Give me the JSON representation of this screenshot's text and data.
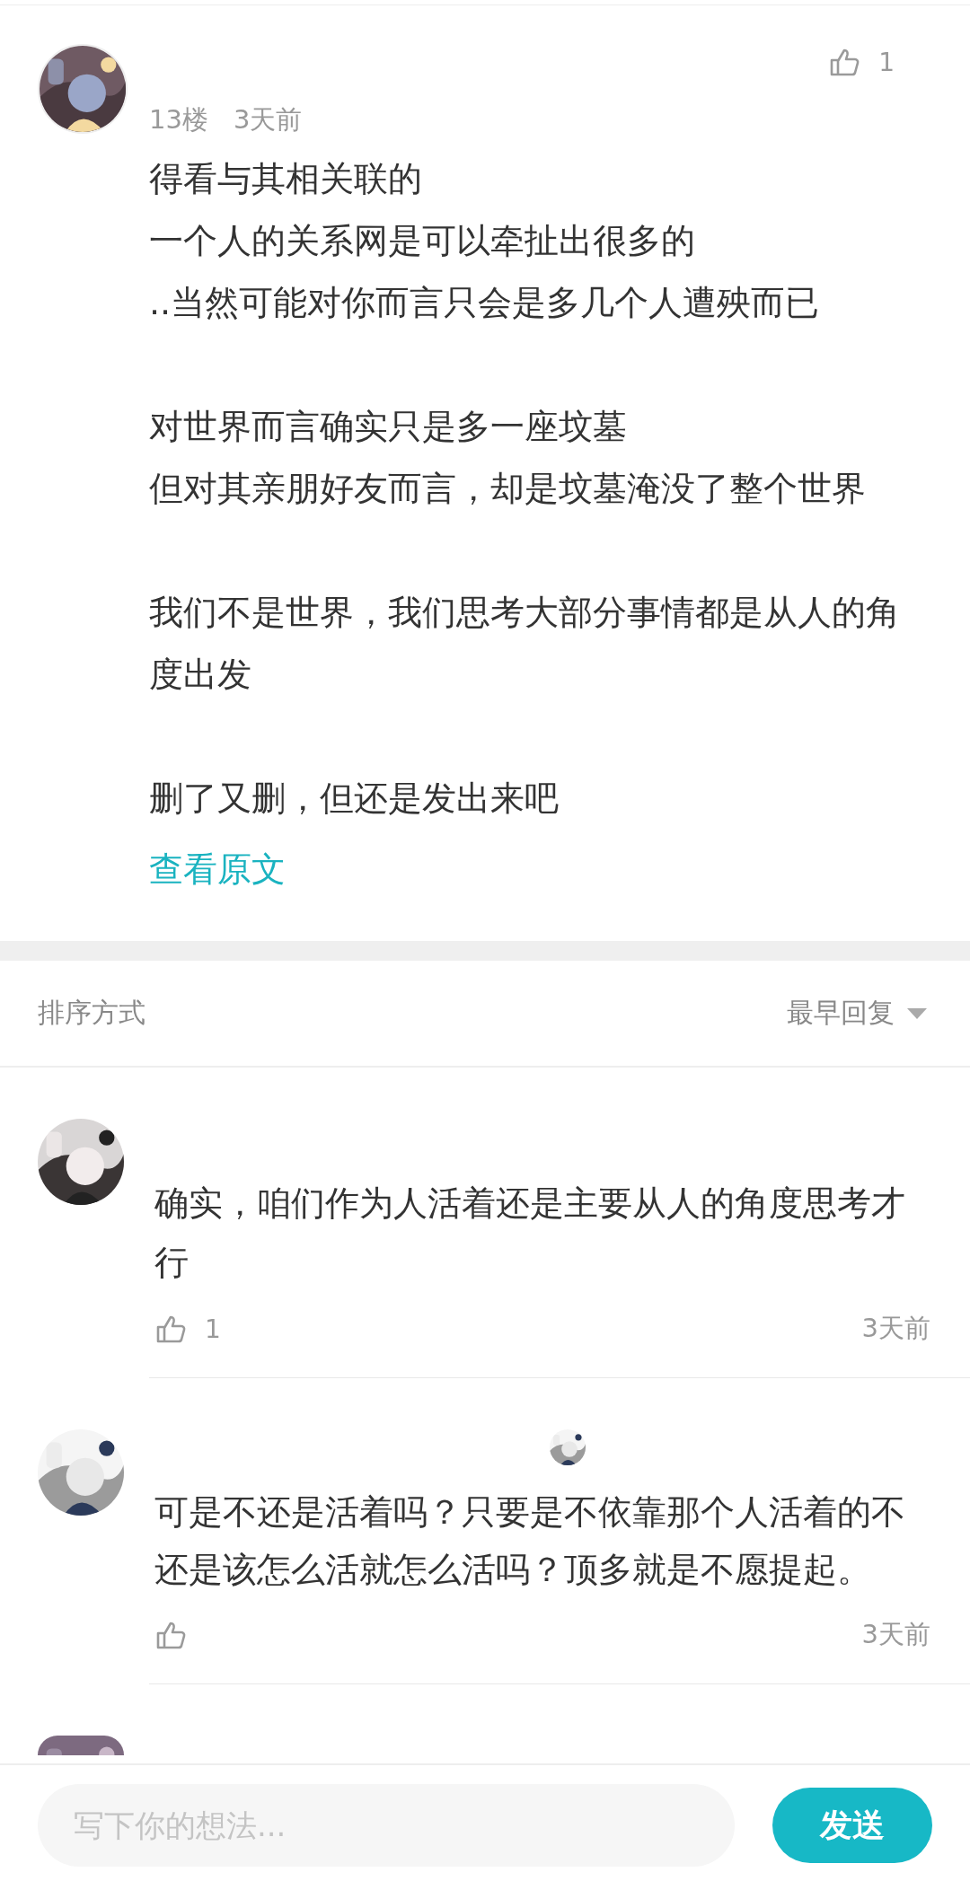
{
  "post": {
    "floor": "13楼",
    "time": "3天前",
    "likes": "1",
    "paragraphs": [
      [
        "得看与其相关联的",
        "一个人的关系网是可以牵扯出很多的",
        "..当然可能对你而言只会是多几个人遭殃而已"
      ],
      [
        "对世界而言确实只是多一座坟墓",
        "但对其亲朋好友而言，却是坟墓淹没了整个世界"
      ],
      [
        "我们不是世界，我们思考大部分事情都是从人的角度出发"
      ],
      [
        "删了又删，但还是发出来吧"
      ]
    ],
    "view_original": "查看原文"
  },
  "sort": {
    "label": "排序方式",
    "value": "最早回复"
  },
  "replies": [
    {
      "text": "确实，咱们作为人活着还是主要从人的角度思考才行",
      "likes": "1",
      "time": "3天前"
    },
    {
      "text": "可是不还是活着吗？只要是不依靠那个人活着的不还是该怎么活就怎么活吗？顶多就是不愿提起。",
      "time": "3天前"
    }
  ],
  "composer": {
    "placeholder": "写下你的想法...",
    "send": "发送"
  }
}
